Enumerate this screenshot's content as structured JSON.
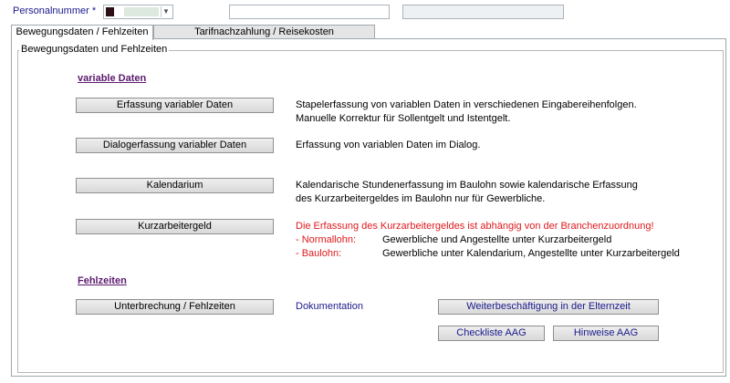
{
  "header": {
    "personalnummer_label": "Personalnummer *",
    "field2_value": "",
    "field3_value": ""
  },
  "tabs": [
    {
      "label": "Bewegungsdaten / Fehlzeiten",
      "active": true
    },
    {
      "label": "Tarifnachzahlung / Reisekosten",
      "active": false
    }
  ],
  "group": {
    "legend": "Bewegungsdaten und Fehlzeiten"
  },
  "variable": {
    "title": "variable Daten",
    "rows": [
      {
        "button": "Erfassung variabler Daten",
        "desc1": "Stapelerfassung von variablen Daten in verschiedenen Eingabereihenfolgen.",
        "desc2": "Manuelle Korrektur für Sollentgelt und Istentgelt."
      },
      {
        "button": "Dialogerfassung variabler Daten",
        "desc1": "Erfassung von variablen Daten im Dialog."
      },
      {
        "button": "Kalendarium",
        "desc1": "Kalendarische Stundenerfassung im Baulohn sowie kalendarische Erfassung",
        "desc2": "des Kurzarbeitergeldes im Baulohn nur für Gewerbliche."
      },
      {
        "button": "Kurzarbeitergeld",
        "desc1": "Die Erfassung des Kurzarbeitergeldes ist abhängig von der Branchenzuordnung!",
        "normal_key": "- Normallohn:",
        "normal_val": "Gewerbliche und Angestellte unter Kurzarbeitergeld",
        "bau_key": "- Baulohn:",
        "bau_val": "Gewerbliche unter Kalendarium, Angestellte unter Kurzarbeitergeld"
      }
    ]
  },
  "fehlzeiten": {
    "title": "Fehlzeiten",
    "button": "Unterbrechung / Fehlzeiten",
    "doc_link": "Dokumentation",
    "elternzeit_button": "Weiterbeschäftigung in der Elternzeit",
    "checkliste_button": "Checkliste AAG",
    "hinweise_button": "Hinweise AAG"
  },
  "colors": {
    "accent_blue": "#1a1a8c",
    "section_purple": "#5b1a6e",
    "warning_red": "#e0191c"
  }
}
